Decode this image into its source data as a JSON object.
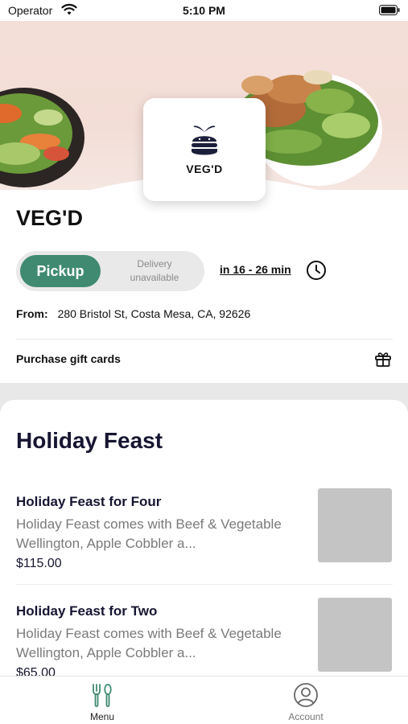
{
  "status_bar": {
    "carrier": "Operator",
    "time": "5:10 PM"
  },
  "store": {
    "logo_text": "VEG'D",
    "name": "VEG'D",
    "pickup_label": "Pickup",
    "delivery_label": "Delivery unavailable",
    "eta": "in 16 - 26 min",
    "from_label": "From:",
    "address": "280 Bristol St, Costa Mesa, CA, 92626",
    "gift_cards_label": "Purchase gift cards"
  },
  "menu": {
    "section_title": "Holiday Feast",
    "items": [
      {
        "title": "Holiday Feast for Four",
        "description": "Holiday Feast comes with Beef & Vegetable Wellington, Apple Cobbler a...",
        "price": "$115.00"
      },
      {
        "title": "Holiday Feast for Two",
        "description": "Holiday Feast comes with Beef & Vegetable Wellington, Apple Cobbler a...",
        "price": "$65.00"
      }
    ]
  },
  "tabs": [
    {
      "label": "Menu",
      "icon": "fork-knife-icon",
      "active": true
    },
    {
      "label": "Account",
      "icon": "account-icon",
      "active": false
    }
  ],
  "colors": {
    "accent": "#3f8a70",
    "title_text": "#161632",
    "muted_text": "#7a7a7a",
    "tab_active": "#3f8a70"
  }
}
